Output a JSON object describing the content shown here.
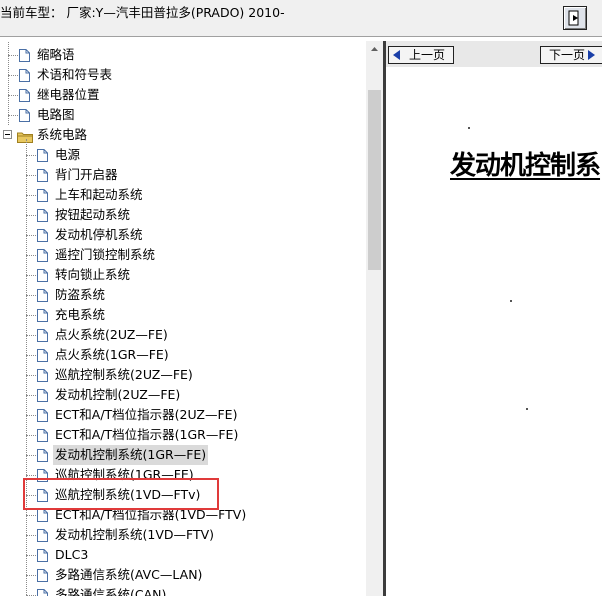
{
  "window": {
    "title": "当前车型：  厂家:Y—汽丰田普拉多(PRADO) 2010-"
  },
  "tree": {
    "top_items": [
      "缩略语",
      "术语和符号表",
      "继电器位置",
      "电路图"
    ],
    "folder": "系统电路",
    "children": [
      "电源",
      "背门开启器",
      "上车和起动系统",
      "按钮起动系统",
      "发动机停机系统",
      "遥控门锁控制系统",
      "转向锁止系统",
      "防盗系统",
      "充电系统",
      "点火系统(2UZ—FE)",
      "点火系统(1GR—FE)",
      "巡航控制系统(2UZ—FE)",
      "发动机控制(2UZ—FE)",
      "ECT和A/T档位指示器(2UZ—FE)",
      "ECT和A/T档位指示器(1GR—FE)",
      "发动机控制系统(1GR—FE)",
      "巡航控制系统(1GR—FE)",
      "巡航控制系统(1VD—FTv)",
      "ECT和A/T档位指示器(1VD—FTV)",
      "发动机控制系统(1VD—FTV)",
      "DLC3",
      "多路通信系统(AVC—LAN)",
      "多路通信系统(CAN)"
    ],
    "selected": "发动机控制系统(1GR—FE)"
  },
  "doc": {
    "prev_label": "上一页",
    "next_label": "下一页",
    "title": "发动机控制系"
  },
  "colors": {
    "highlight": "#e03a3a",
    "nav_arrow": "#1a3fa8",
    "folder": "#e8c860"
  }
}
